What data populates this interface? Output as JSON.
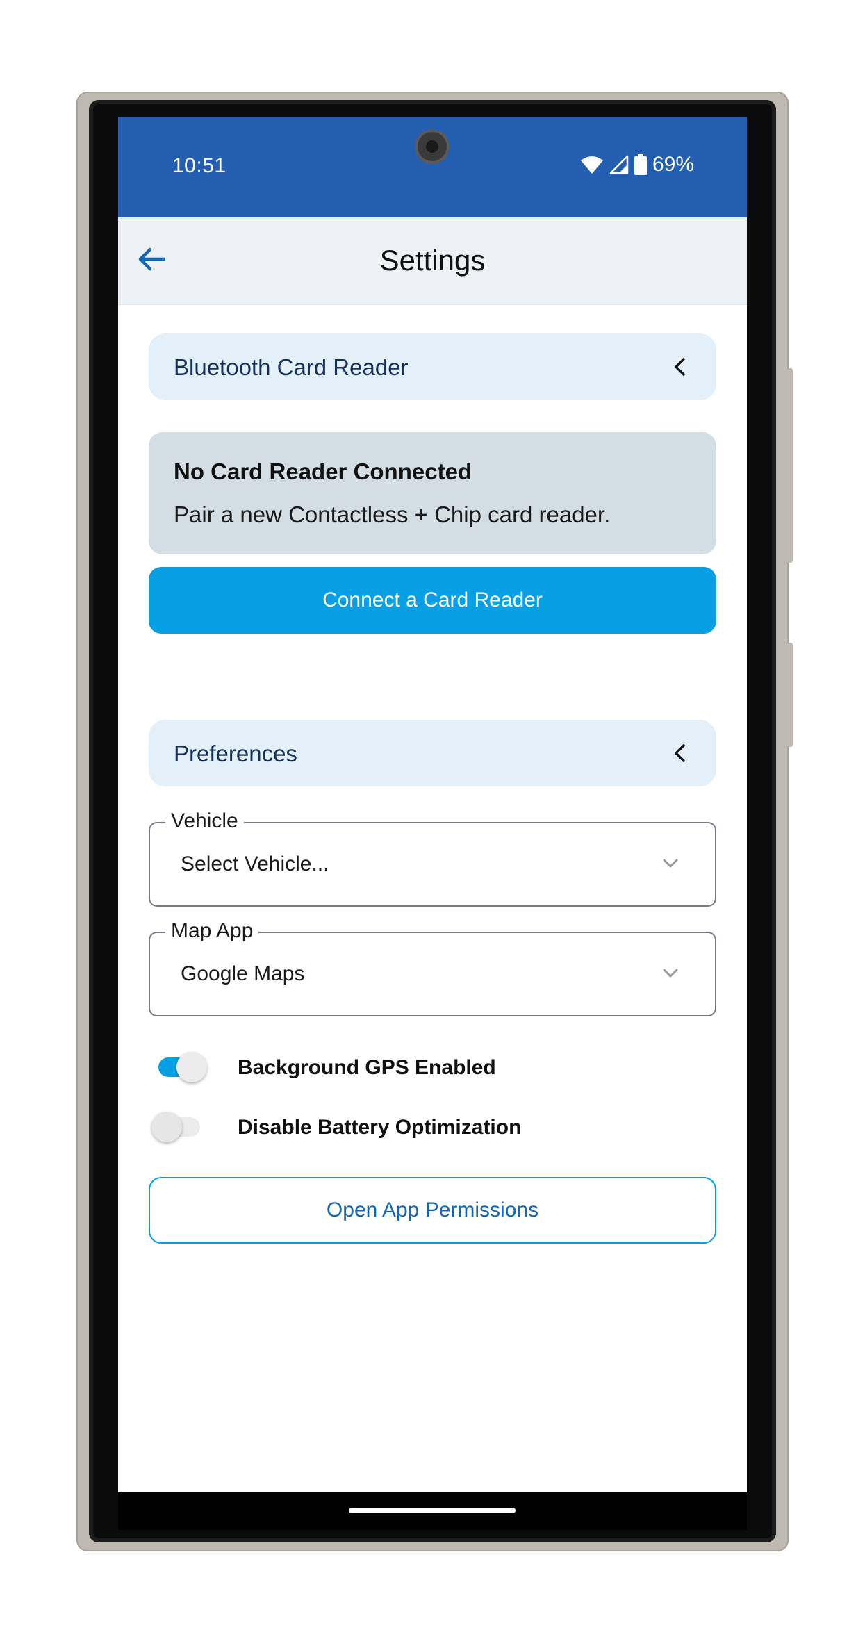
{
  "status_bar": {
    "time": "10:51",
    "battery": "69%"
  },
  "app_bar": {
    "title": "Settings"
  },
  "bluetooth_section": {
    "header": "Bluetooth Card Reader",
    "reader_status_title": "No Card Reader Connected",
    "reader_status_subtitle": "Pair a new Contactless + Chip card reader.",
    "connect_button": "Connect a Card Reader"
  },
  "preferences_section": {
    "header": "Preferences",
    "vehicle": {
      "label": "Vehicle",
      "value": "Select Vehicle..."
    },
    "map_app": {
      "label": "Map App",
      "value": "Google Maps"
    },
    "toggles": [
      {
        "label": "Background GPS Enabled",
        "on": true
      },
      {
        "label": "Disable Battery Optimization",
        "on": false
      }
    ],
    "permissions_button": "Open App Permissions"
  },
  "colors": {
    "status_bar": "#245eb0",
    "accent": "#069fe3",
    "link_text": "#1466b0",
    "section_header_bg": "#e3eff9",
    "reader_card_bg": "#d3dde4"
  },
  "icons": {
    "back": "arrow-left-icon",
    "section_toggle": "chevron-left-icon",
    "dropdown": "chevron-down-icon",
    "wifi": "wifi-icon",
    "signal": "cell-signal-icon",
    "battery": "battery-icon"
  }
}
